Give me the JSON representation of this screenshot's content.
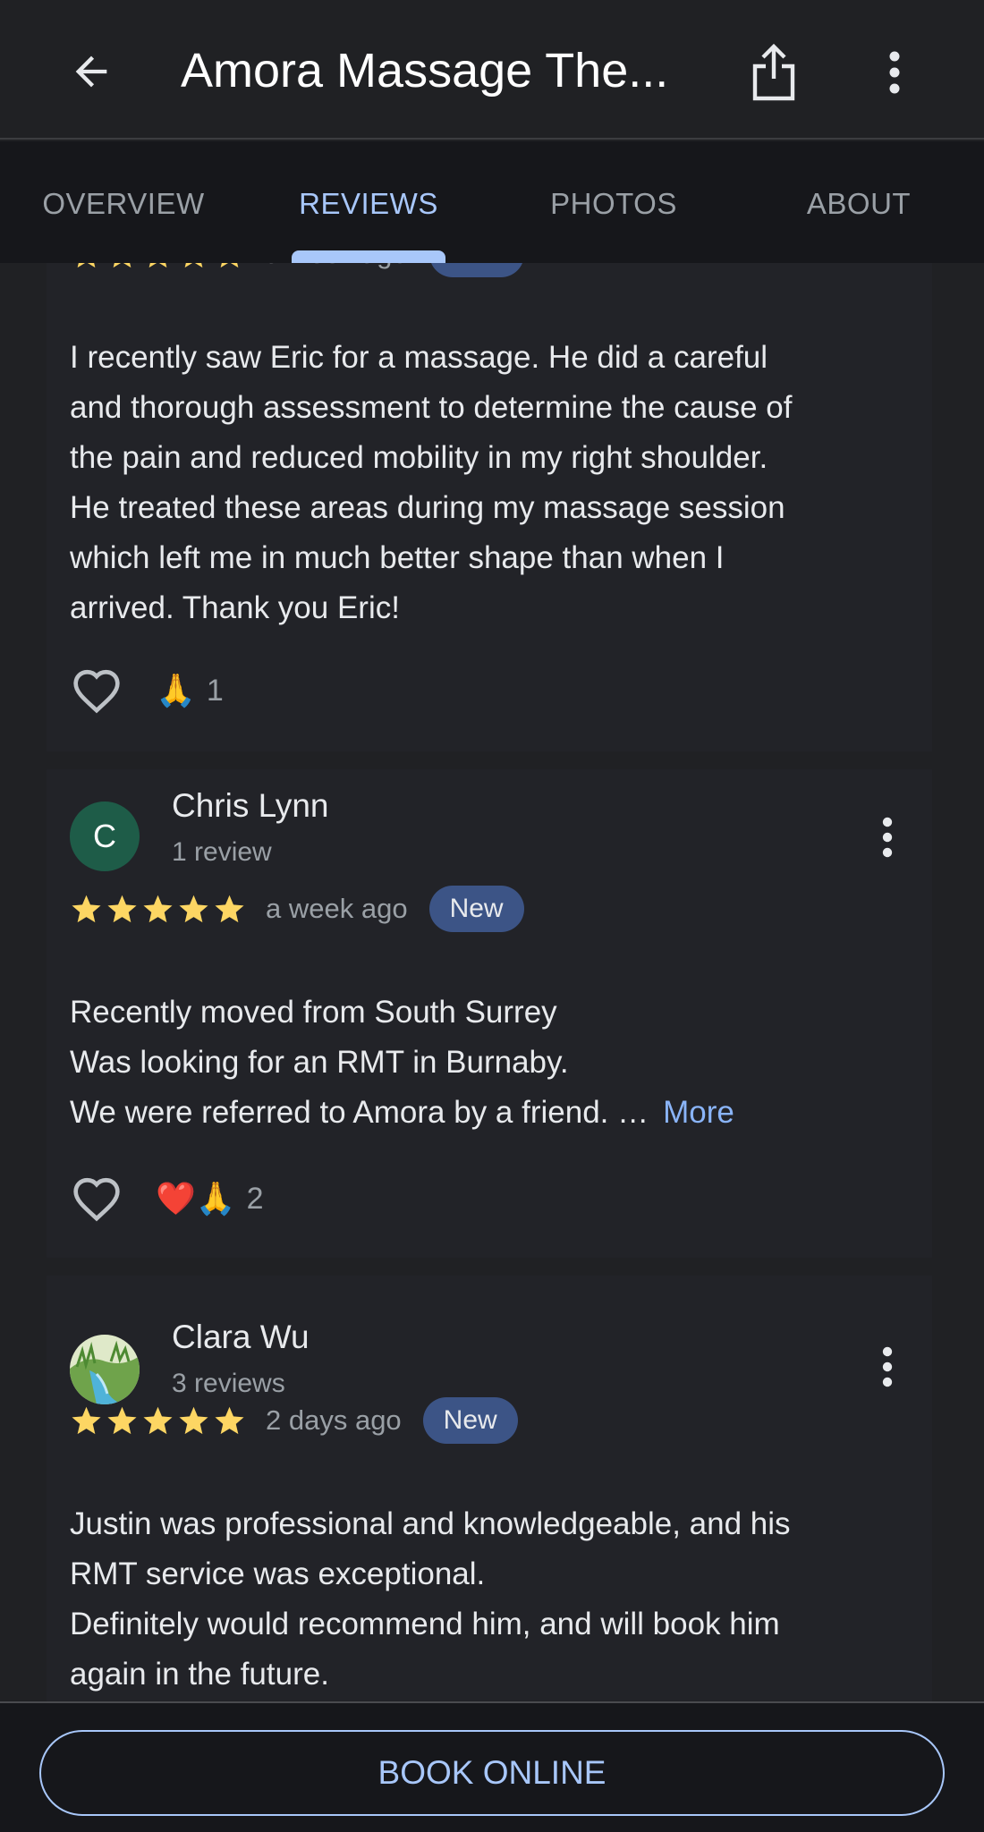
{
  "header": {
    "title": "Amora Massage The...",
    "back_icon": "arrow-left-icon",
    "share_icon": "share-icon",
    "more_icon": "more-vert-icon"
  },
  "tabs": [
    {
      "label": "OVERVIEW",
      "active": false
    },
    {
      "label": "REVIEWS",
      "active": true
    },
    {
      "label": "PHOTOS",
      "active": false
    },
    {
      "label": "ABOUT",
      "active": false
    }
  ],
  "reviews": [
    {
      "rating": 5,
      "time_ago": "a week ago",
      "badge": "New",
      "text_lines": [
        "I recently saw Eric for a massage. He did a careful",
        "and thorough assessment to determine the cause of",
        "the pain and reduced mobility in my right shoulder.",
        "He treated these areas during my massage session",
        "which left me in much better shape than when I",
        "arrived. Thank you Eric!"
      ],
      "reactions_emoji": "🙏",
      "reactions_count": "1"
    },
    {
      "author": "Chris Lynn",
      "author_sub": "1 review",
      "avatar_letter": "C",
      "rating": 5,
      "time_ago": "a week ago",
      "badge": "New",
      "text_lines": [
        "Recently moved from South Surrey",
        "Was looking for an RMT in Burnaby.",
        "We were referred to Amora by a friend. …"
      ],
      "more_label": "More",
      "reactions_emoji": "❤️🙏",
      "reactions_count": "2"
    },
    {
      "author": "Clara Wu",
      "author_sub": "3 reviews",
      "avatar_icon": "waterfall-photo-avatar",
      "rating": 5,
      "time_ago": "2 days ago",
      "badge": "New",
      "text_lines": [
        "Justin was professional and knowledgeable, and his",
        "RMT service was exceptional.",
        "Definitely would recommend him, and will book him",
        "again in the future."
      ]
    }
  ],
  "bottom": {
    "book_label": "BOOK ONLINE"
  },
  "colors": {
    "accent": "#a8c7fa",
    "star": "#fdd663",
    "badge_bg": "#3c5486",
    "link": "#8ab4f8"
  }
}
